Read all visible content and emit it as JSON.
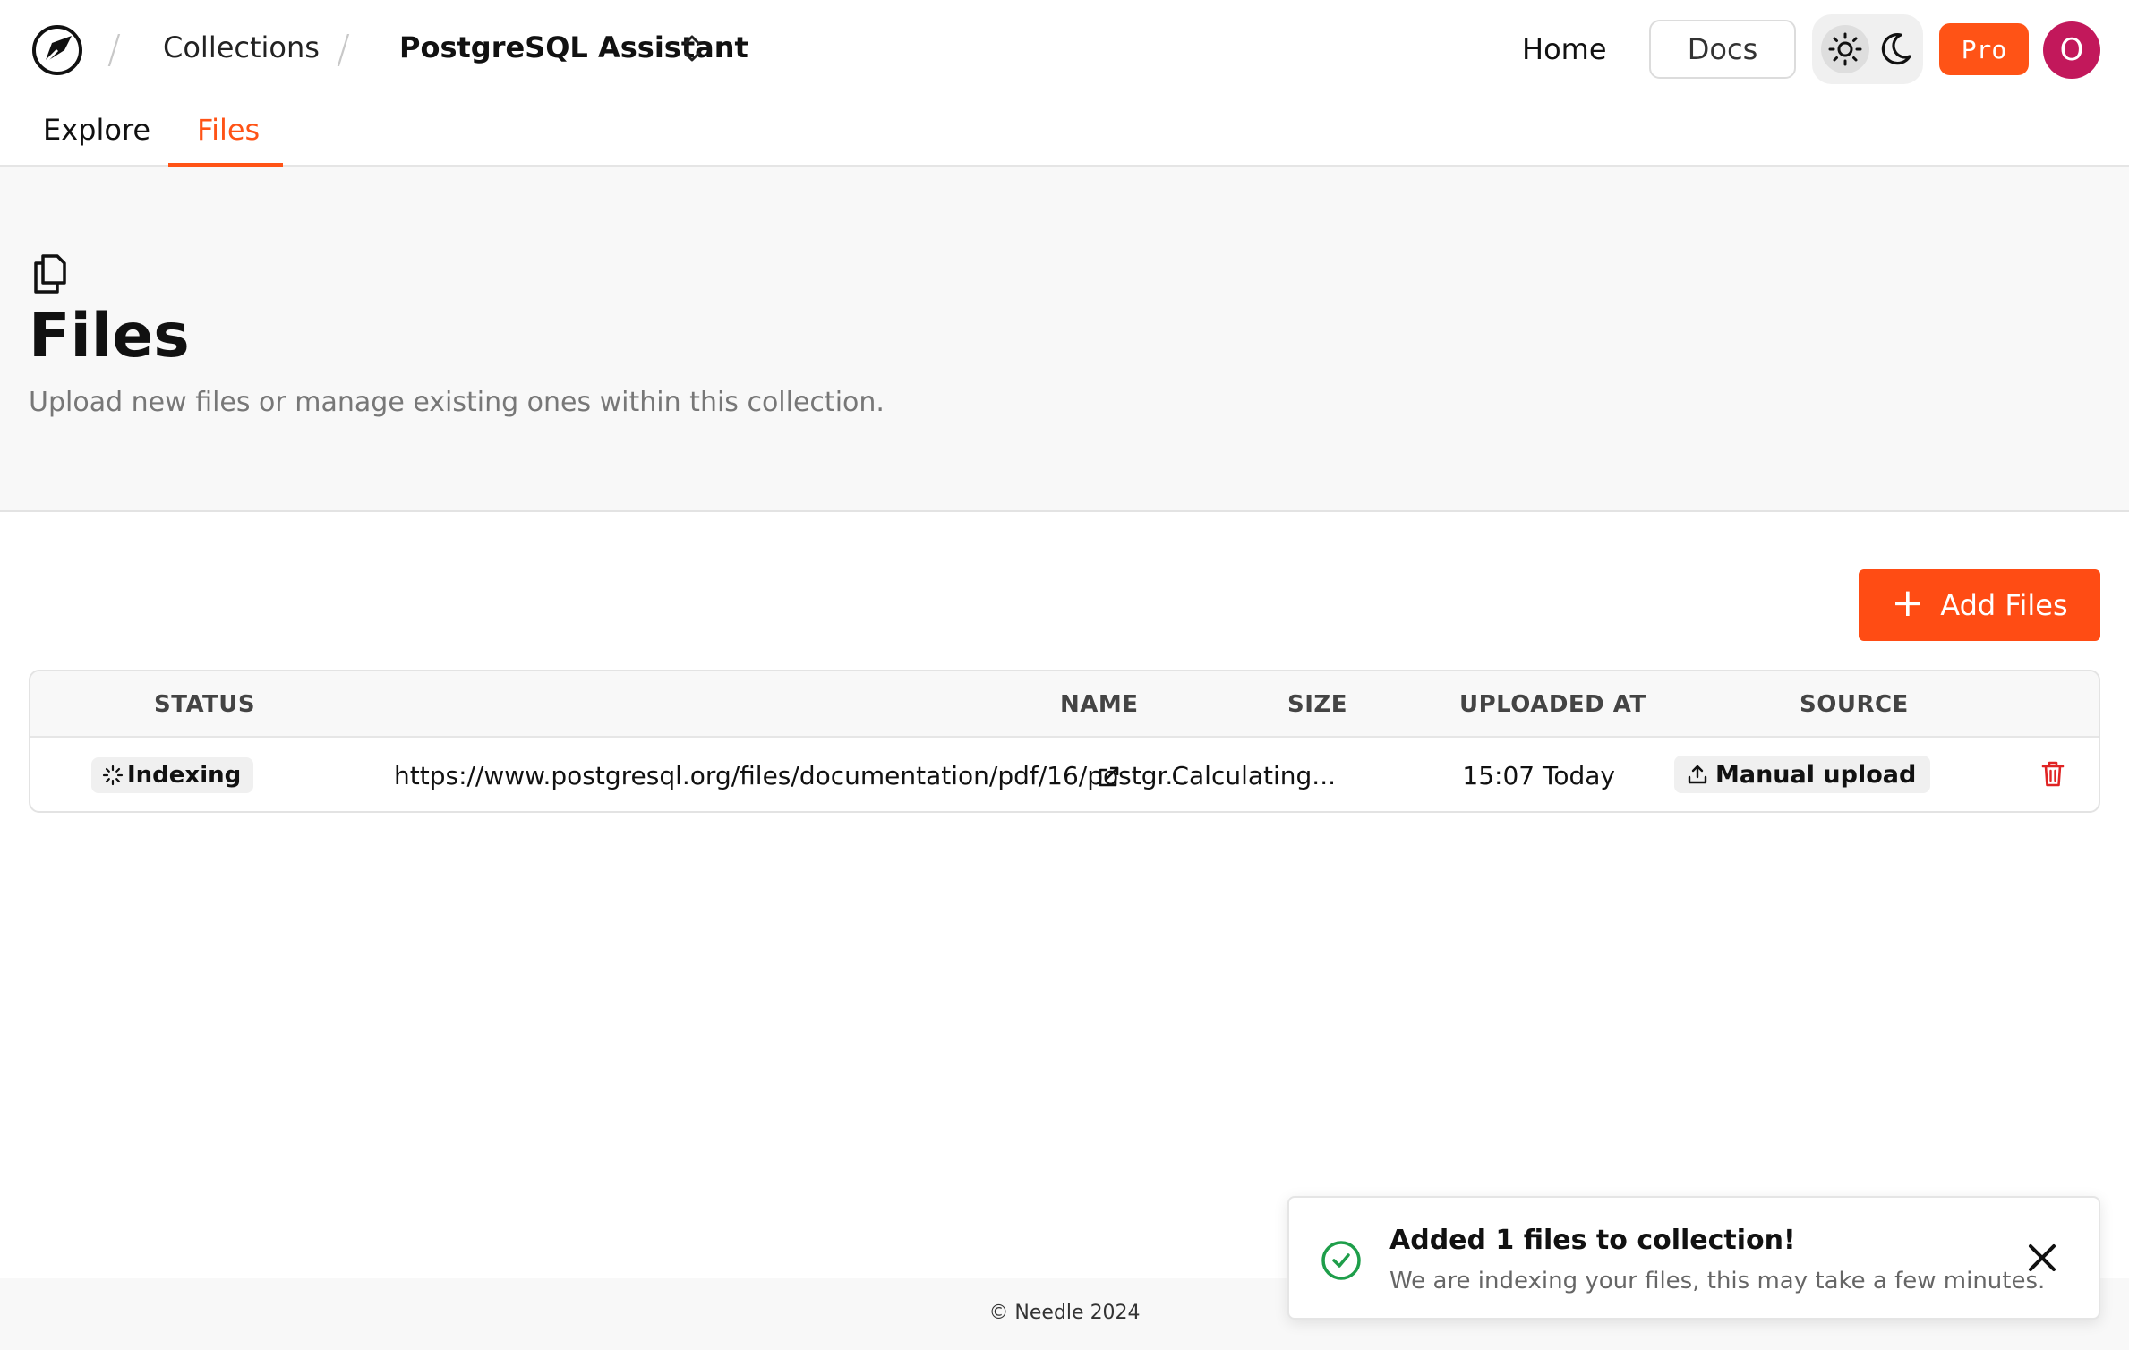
{
  "header": {
    "logo_icon": "needle-compass-icon",
    "breadcrumbs": [
      "Collections",
      "PostgreSQL Assistant"
    ],
    "nav": {
      "home_label": "Home",
      "docs_label": "Docs",
      "pro_label": "Pro",
      "avatar_initial": "O"
    },
    "theme_toggle": {
      "selected": "light",
      "options": [
        "sun-icon",
        "moon-icon"
      ]
    }
  },
  "tabs": [
    {
      "label": "Explore",
      "active": false
    },
    {
      "label": "Files",
      "active": true
    }
  ],
  "section": {
    "icon": "files-copy-icon",
    "title": "Files",
    "subtitle": "Upload new files or manage existing ones within this collection."
  },
  "actions": {
    "add_files_label": "Add Files"
  },
  "table": {
    "columns": [
      "STATUS",
      "NAME",
      "SIZE",
      "UPLOADED AT",
      "SOURCE"
    ],
    "rows": [
      {
        "status": "Indexing",
        "name": "https://www.postgresql.org/files/documentation/pdf/16/postgr...",
        "size": "Calculating...",
        "uploaded_at": "15:07 Today",
        "source": "Manual upload"
      }
    ]
  },
  "footer": {
    "copyright": "© Needle 2024"
  },
  "toast": {
    "title": "Added 1 files to collection!",
    "message": "We are indexing your files, this may take a few minutes."
  },
  "colors": {
    "accent": "#ff5316",
    "avatar": "#c2185b",
    "success": "#1e9e4a",
    "danger": "#e02424"
  }
}
